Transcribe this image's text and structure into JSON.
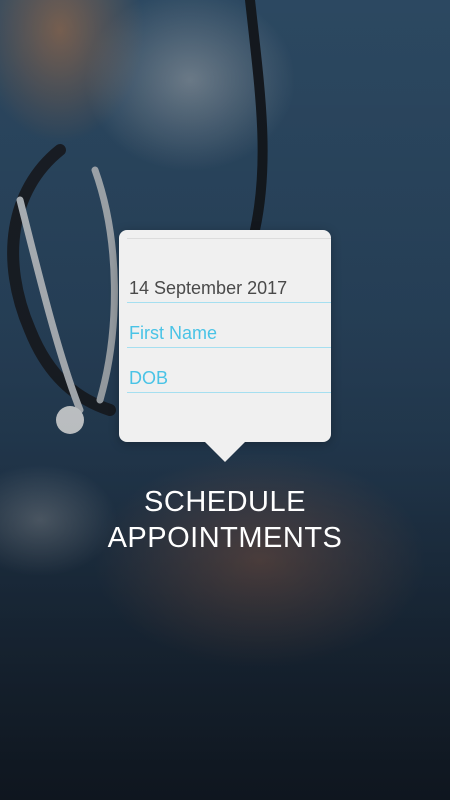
{
  "form": {
    "date_value": "14 September 2017",
    "first_name_placeholder": "First Name",
    "dob_placeholder": "DOB"
  },
  "caption": {
    "line1": "SCHEDULE",
    "line2": "APPOINTMENTS"
  },
  "colors": {
    "card_background": "#f0f0f0",
    "accent": "#49c3e6",
    "field_underline": "#a5dff0",
    "value_text": "#4a4a4a",
    "caption_text": "#ffffff"
  },
  "background": {
    "image": "nurse-holding-patient-hands-photo"
  }
}
